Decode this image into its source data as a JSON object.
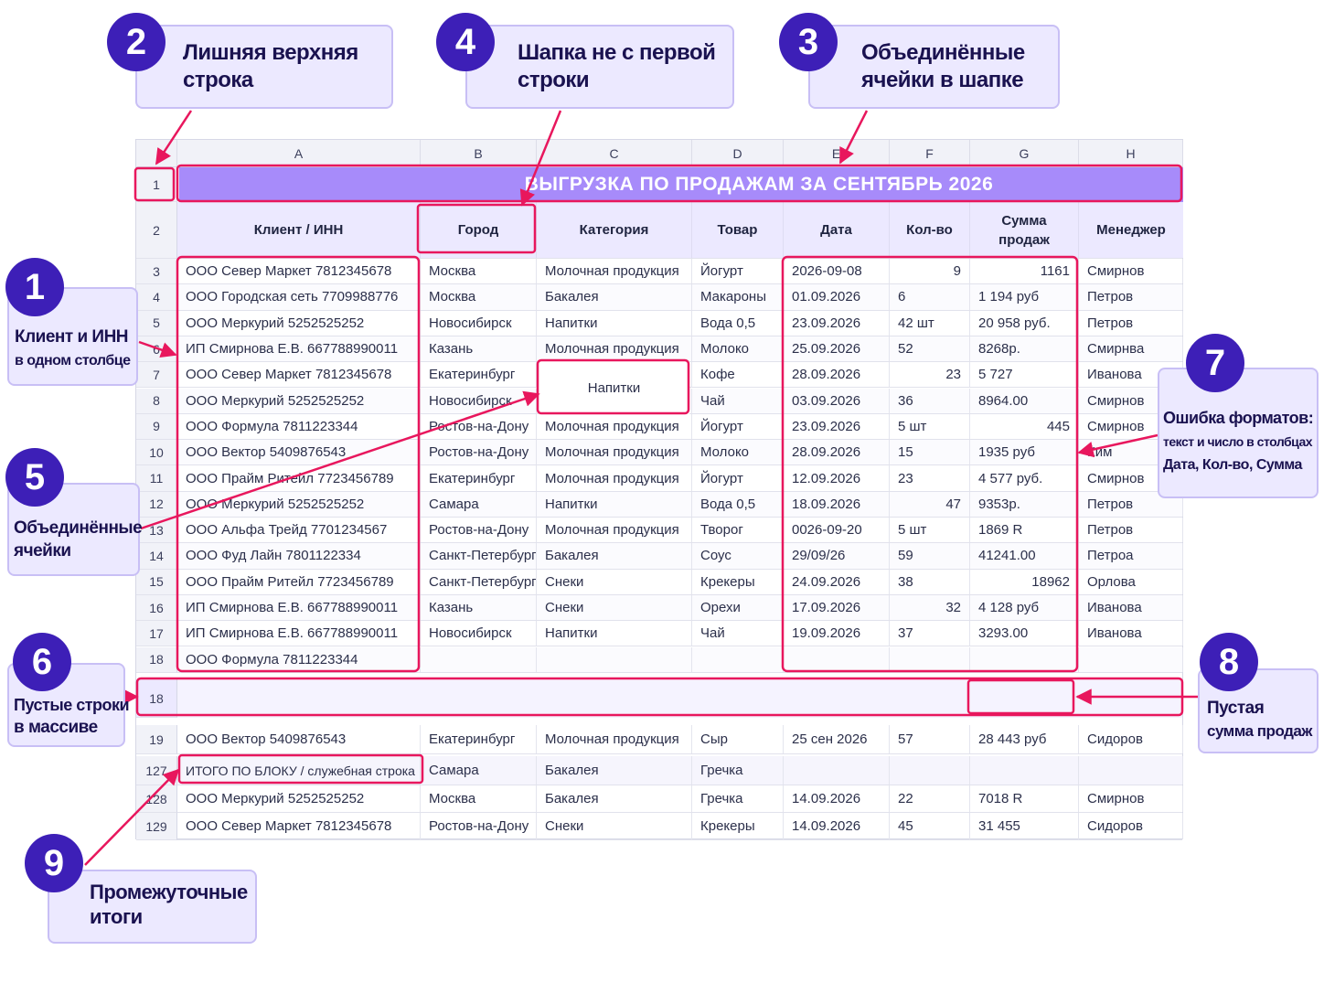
{
  "sheet": {
    "columns": [
      "A",
      "B",
      "C",
      "D",
      "E",
      "F",
      "G",
      "H"
    ],
    "title": "ВЫГРУЗКА ПО ПРОДАЖАМ ЗА СЕНТЯБРЬ 2026",
    "header_row_num": "2",
    "title_row_num": "1",
    "headers": {
      "client": "Клиент / ИНН",
      "city": "Город",
      "category": "Категория",
      "product": "Товар",
      "date": "Дата",
      "qty": "Кол-во",
      "sum_line1": "Сумма",
      "sum_line2": "продаж",
      "manager": "Менеджер"
    },
    "merged_text": "Напитки",
    "rows": [
      {
        "n": "3",
        "client": "ООО Север Маркет 7812345678",
        "city": "Москва",
        "category": "Молочная продукция",
        "product": "Йогурт",
        "date": "2026-09-08",
        "qty": "9",
        "sum": "1161",
        "manager": "Смирнов"
      },
      {
        "n": "4",
        "client": "ООО Городская сеть 7709988776",
        "city": "Москва",
        "category": "Бакалея",
        "product": "Макароны",
        "date": "01.09.2026",
        "qty": "6",
        "sum": "1 194 руб",
        "manager": "Петров"
      },
      {
        "n": "5",
        "client": "ООО Меркурий 5252525252",
        "city": "Новосибирск",
        "category": "Напитки",
        "product": "Вода 0,5",
        "date": "23.09.2026",
        "qty": "42 шт",
        "sum": "20 958 руб.",
        "manager": "Петров"
      },
      {
        "n": "6",
        "client": "ИП Смирнова Е.В. 667788990011",
        "city": "Казань",
        "category": "Молочная продукция",
        "product": "Молоко",
        "date": "25.09.2026",
        "qty": "52",
        "sum": "8268р.",
        "manager": "Смирнва"
      },
      {
        "n": "7",
        "client": "ООО Север Маркет 7812345678",
        "city": "Екатеринбург",
        "category": "",
        "product": "Кофе",
        "date": "28.09.2026",
        "qty": "23",
        "sum": "5 727",
        "manager": "Иванова"
      },
      {
        "n": "8",
        "client": "ООО Меркурий 5252525252",
        "city": "Новосибирск",
        "category": "",
        "product": "Чай",
        "date": "03.09.2026",
        "qty": "36",
        "sum": "8964.00",
        "manager": "Смирнов"
      },
      {
        "n": "9",
        "client": "ООО Формула 7811223344",
        "city": "Ростов-на-Дону",
        "category": "Молочная продукция",
        "product": "Йогурт",
        "date": "23.09.2026",
        "qty": "5 шт",
        "sum": "445",
        "manager": "Смирнов"
      },
      {
        "n": "10",
        "client": "ООО Вектор 5409876543",
        "city": "Ростов-на-Дону",
        "category": "Молочная продукция",
        "product": "Молоко",
        "date": "28.09.2026",
        "qty": "15",
        "sum": "1935 руб",
        "manager": "Ким"
      },
      {
        "n": "11",
        "client": "ООО Прайм Ритейл 7723456789",
        "city": "Екатеринбург",
        "category": "Молочная продукция",
        "product": "Йогурт",
        "date": "12.09.2026",
        "qty": "23",
        "sum": "4 577 руб.",
        "manager": "Смирнов"
      },
      {
        "n": "12",
        "client": "ООО Меркурий 5252525252",
        "city": "Самара",
        "category": "Напитки",
        "product": "Вода 0,5",
        "date": "18.09.2026",
        "qty": "47",
        "sum": "9353р.",
        "manager": "Петров"
      },
      {
        "n": "13",
        "client": "ООО Альфа Трейд 7701234567",
        "city": "Ростов-на-Дону",
        "category": "Молочная продукция",
        "product": "Творог",
        "date": "0026-09-20",
        "qty": "5 шт",
        "sum": "1869 R",
        "manager": "Петров"
      },
      {
        "n": "14",
        "client": "ООО Фуд Лайн 7801122334",
        "city": "Санкт-Петербург",
        "category": "Бакалея",
        "product": "Соус",
        "date": "29/09/26",
        "qty": "59",
        "sum": "41241.00",
        "manager": "Петроа"
      },
      {
        "n": "15",
        "client": "ООО Прайм Ритейл 7723456789",
        "city": "Санкт-Петербург",
        "category": "Снеки",
        "product": "Крекеры",
        "date": "24.09.2026",
        "qty": "38",
        "sum": "18962",
        "manager": "Орлова"
      },
      {
        "n": "16",
        "client": "ИП Смирнова Е.В. 667788990011",
        "city": "Казань",
        "category": "Снеки",
        "product": "Орехи",
        "date": "17.09.2026",
        "qty": "32",
        "sum": "4 128 руб",
        "manager": "Иванова"
      },
      {
        "n": "17",
        "client": "ИП Смирнова Е.В. 667788990011",
        "city": "Новосибирск",
        "category": "Напитки",
        "product": "Чай",
        "date": "19.09.2026",
        "qty": "37",
        "sum": "3293.00",
        "manager": "Иванова"
      },
      {
        "n": "18",
        "client": "ООО Формула 7811223344",
        "city": "",
        "category": "",
        "product": "",
        "date": "",
        "qty": "",
        "sum": "",
        "manager": ""
      }
    ],
    "empty_row_num": "18",
    "bottom_rows": [
      {
        "n": "19",
        "client": "ООО Вектор 5409876543",
        "city": "Екатеринбург",
        "category": "Молочная продукция",
        "product": "Сыр",
        "date": "25 сен 2026",
        "qty": "57",
        "sum": "28 443 руб",
        "manager": "Сидоров"
      },
      {
        "n": "127",
        "client": "ИТОГО ПО БЛОКУ / служебная строка",
        "city": "Самара",
        "category": "Бакалея",
        "product": "Гречка",
        "date": "",
        "qty": "",
        "sum": "",
        "manager": ""
      },
      {
        "n": "128",
        "client": "ООО Меркурий 5252525252",
        "city": "Москва",
        "category": "Бакалея",
        "product": "Гречка",
        "date": "14.09.2026",
        "qty": "22",
        "sum": "7018 R",
        "manager": "Смирнов"
      },
      {
        "n": "129",
        "client": "ООО Север Маркет 7812345678",
        "city": "Ростов-на-Дону",
        "category": "Снеки",
        "product": "Крекеры",
        "date": "14.09.2026",
        "qty": "45",
        "sum": "31 455",
        "manager": "Сидоров"
      }
    ]
  },
  "annotations": {
    "a1": {
      "num": "1",
      "line1": "Клиент и ИНН",
      "line2": "в одном столбце"
    },
    "a2": {
      "num": "2",
      "line1": "Лишняя верхняя",
      "line2": "строка"
    },
    "a3": {
      "num": "3",
      "line1": "Объединённые",
      "line2": "ячейки в шапке"
    },
    "a4": {
      "num": "4",
      "line1": "Шапка не с первой",
      "line2": "строки"
    },
    "a5": {
      "num": "5",
      "line1": "Объединённые",
      "line2": "ячейки"
    },
    "a6": {
      "num": "6",
      "line1": "Пустые строки",
      "line2": "в массиве"
    },
    "a7": {
      "num": "7",
      "line1": "Ошибка форматов:",
      "line2": "текст и число в столбцах",
      "line3": "Дата, Кол-во, Сумма"
    },
    "a8": {
      "num": "8",
      "line1": "Пустая",
      "line2": "сумма продаж"
    },
    "a9": {
      "num": "9",
      "line1": "Промежуточные",
      "line2": "итоги"
    }
  },
  "colors": {
    "accent": "#3d1fb7",
    "highlight": "#e8175d",
    "title_bar": "#a78bfa",
    "callout_bg": "#ece9ff"
  }
}
